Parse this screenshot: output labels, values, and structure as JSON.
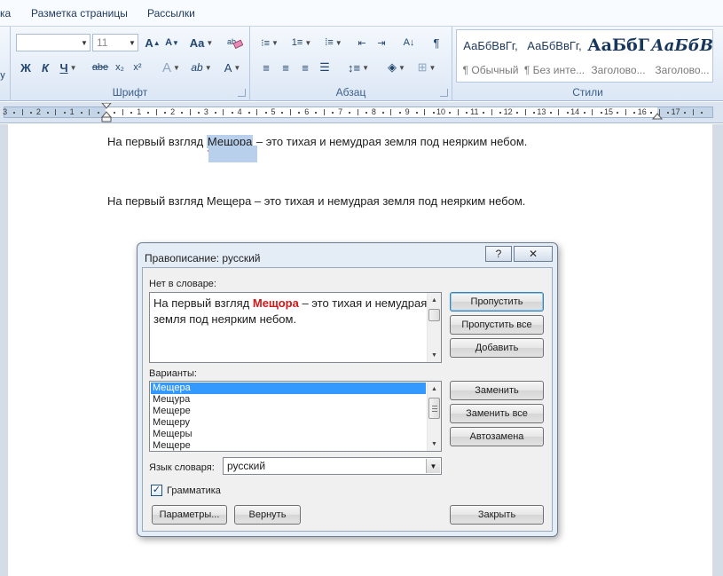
{
  "ribbon": {
    "tabs": [
      {
        "label": "ка"
      },
      {
        "label": "Разметка страницы"
      },
      {
        "label": "Рассылки"
      }
    ],
    "font": {
      "group_label": "Шрифт",
      "font_name_value": "",
      "font_size_value": "11",
      "grow_font": "A",
      "shrink_font": "A",
      "change_case": "Aa",
      "bold": "Ж",
      "italic": "К",
      "underline": "Ч",
      "strikethrough": "abe",
      "subscript": "x₂",
      "superscript": "x²",
      "text_effects": "A",
      "font_color": "A"
    },
    "paragraph": {
      "group_label": "Абзац",
      "show_marks": "¶"
    },
    "styles": {
      "group_label": "Стили",
      "items": [
        {
          "preview": "АаБбВвГг,",
          "name": "¶ Обычный"
        },
        {
          "preview": "АаБбВвГг,",
          "name": "¶ Без инте..."
        },
        {
          "preview": "АаБбГ",
          "name": "Заголово..."
        },
        {
          "preview": "АаБбВ",
          "name": "Заголово..."
        }
      ]
    }
  },
  "ruler": {
    "numbers": [
      "3",
      "2",
      "1",
      "1",
      "2",
      "3",
      "4",
      "5",
      "6",
      "7",
      "8",
      "9",
      "10",
      "11",
      "12",
      "13",
      "14",
      "15",
      "16",
      "17"
    ]
  },
  "document": {
    "line1_before": "На первый взгляд ",
    "line1_selected": "Мещора",
    "line1_after": " – это тихая и немудрая земля под неярким небом.",
    "line2": "На первый взгляд Мещера – это тихая и немудрая земля под неярким небом."
  },
  "dialog": {
    "title": "Правописание: русский",
    "help_label": "?",
    "close_label": "✕",
    "not_in_dict_label": "Нет в словаре:",
    "sentence_before": "На первый взгляд ",
    "misspelled_word": "Мещора",
    "sentence_after": " – это тихая и немудрая земля под неярким небом.",
    "suggestions_label": "Варианты:",
    "suggestions": [
      "Мещера",
      "Мещура",
      "Мещере",
      "Мещеру",
      "Мещеры",
      "Мещере"
    ],
    "language_label": "Язык словаря:",
    "language_value": "русский",
    "grammar_label": "Грамматика",
    "grammar_checked": true,
    "buttons": {
      "ignore": "Пропустить",
      "ignore_all": "Пропустить все",
      "add": "Добавить",
      "change": "Заменить",
      "change_all": "Заменить все",
      "autocorrect": "Автозамена",
      "options": "Параметры...",
      "undo": "Вернуть",
      "close": "Закрыть"
    }
  }
}
